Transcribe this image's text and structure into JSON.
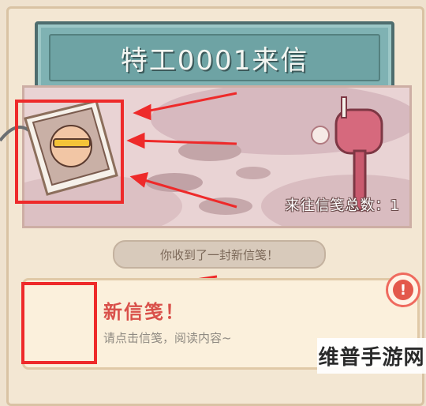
{
  "header": {
    "title": "特工0001来信"
  },
  "scene": {
    "counter_text": "来往信笺总数：1"
  },
  "notice": {
    "text": "你收到了一封新信笺！"
  },
  "letter": {
    "title": "新信笺！",
    "subtitle": "请点击信笺，阅读内容~"
  },
  "watermark": {
    "text": "维普手游网"
  },
  "icons": [
    "stamp-icon",
    "mailbox-icon",
    "envelope-icon",
    "alert-icon",
    "arrow-icon"
  ],
  "colors": {
    "accent_red": "#ee2a2a",
    "title_teal": "#6ea3a4",
    "letter_title": "#d9504a"
  }
}
